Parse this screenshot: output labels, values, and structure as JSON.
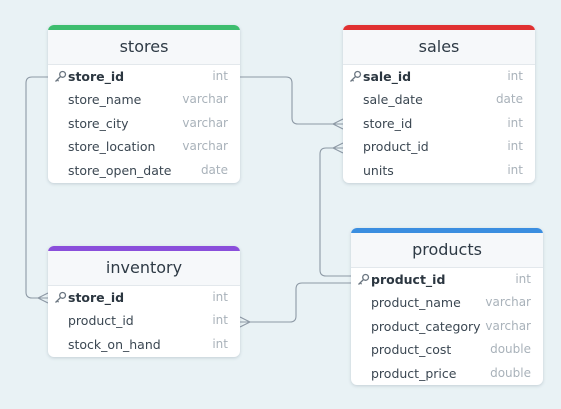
{
  "diagram": {
    "stores": {
      "title": "stores",
      "color": "#3dbd6e",
      "columns": [
        {
          "name": "store_id",
          "type": "int",
          "pk": true
        },
        {
          "name": "store_name",
          "type": "varchar"
        },
        {
          "name": "store_city",
          "type": "varchar"
        },
        {
          "name": "store_location",
          "type": "varchar"
        },
        {
          "name": "store_open_date",
          "type": "date"
        }
      ]
    },
    "sales": {
      "title": "sales",
      "color": "#e03131",
      "columns": [
        {
          "name": "sale_id",
          "type": "int",
          "pk": true
        },
        {
          "name": "sale_date",
          "type": "date"
        },
        {
          "name": "store_id",
          "type": "int"
        },
        {
          "name": "product_id",
          "type": "int"
        },
        {
          "name": "units",
          "type": "int"
        }
      ]
    },
    "inventory": {
      "title": "inventory",
      "color": "#8a4fdb",
      "columns": [
        {
          "name": "store_id",
          "type": "int",
          "pk": true
        },
        {
          "name": "product_id",
          "type": "int"
        },
        {
          "name": "stock_on_hand",
          "type": "int"
        }
      ]
    },
    "products": {
      "title": "products",
      "color": "#3b8ee0",
      "columns": [
        {
          "name": "product_id",
          "type": "int",
          "pk": true
        },
        {
          "name": "product_name",
          "type": "varchar"
        },
        {
          "name": "product_category",
          "type": "varchar"
        },
        {
          "name": "product_cost",
          "type": "double"
        },
        {
          "name": "product_price",
          "type": "double"
        }
      ]
    },
    "relationships": [
      {
        "from": "stores.store_id",
        "to": "sales.store_id",
        "cardinality": "one-to-many"
      },
      {
        "from": "stores.store_id",
        "to": "inventory.store_id",
        "cardinality": "one-to-many"
      },
      {
        "from": "products.product_id",
        "to": "sales.product_id",
        "cardinality": "one-to-many"
      },
      {
        "from": "products.product_id",
        "to": "inventory.product_id",
        "cardinality": "one-to-many"
      }
    ]
  }
}
